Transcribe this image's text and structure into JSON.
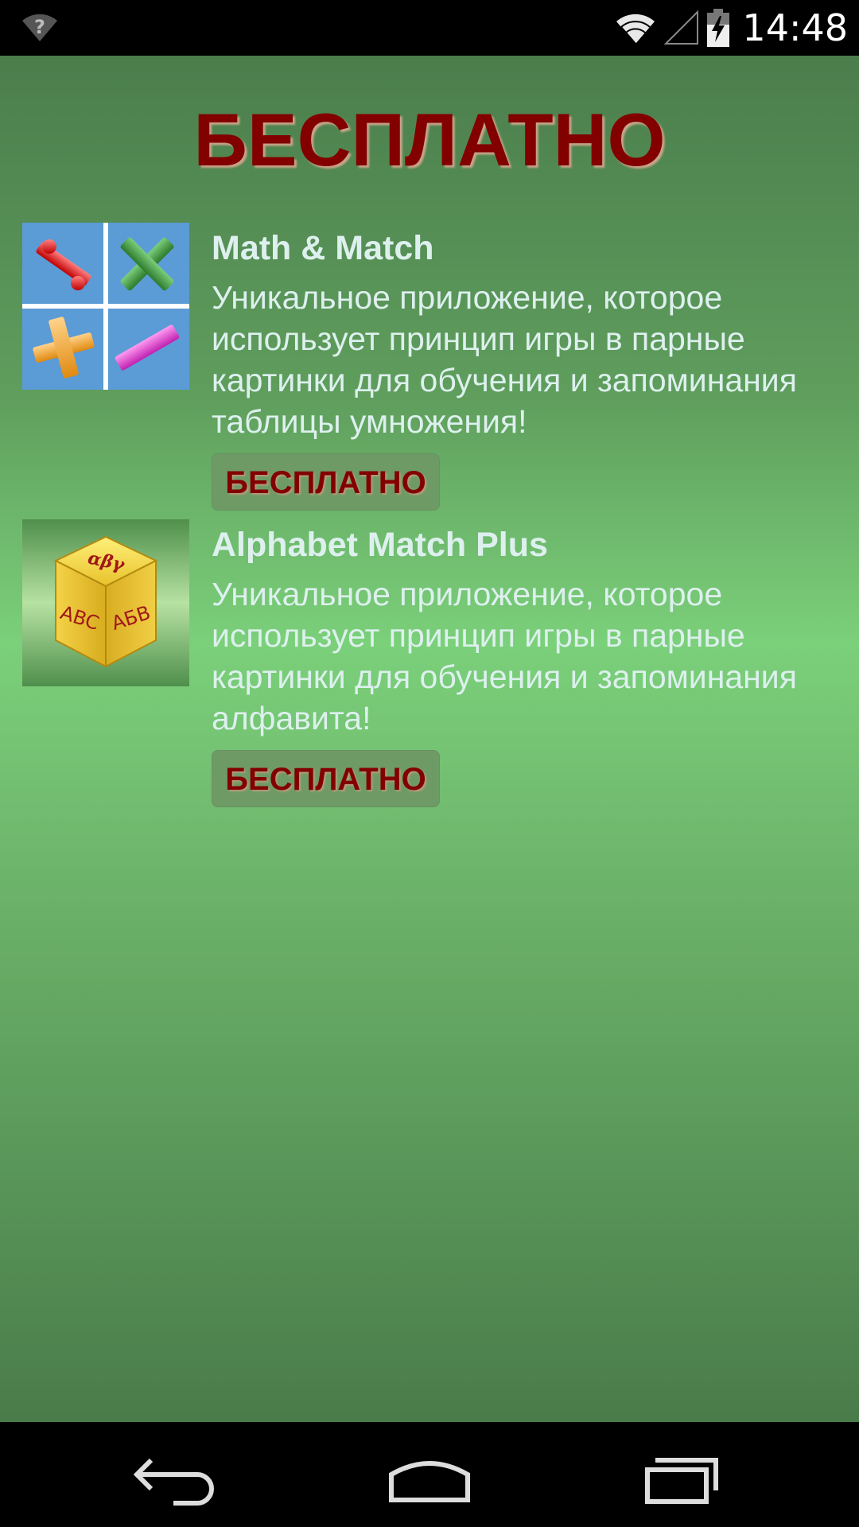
{
  "status_bar": {
    "time": "14:48",
    "icons": [
      "wifi-question-icon",
      "wifi-icon",
      "signal-icon",
      "battery-charging-icon"
    ]
  },
  "page": {
    "title": "БЕСПЛАТНО"
  },
  "apps": [
    {
      "name": "Math & Match",
      "description": "Уникальное приложение, которое использует принцип игры в парные картинки для обучения и запоминания таблицы умножения!",
      "button_label": "БЕСПЛАТНО",
      "icon": "math-operations-icon"
    },
    {
      "name": "Alphabet Match Plus",
      "description": "Уникальное приложение, которое использует принцип игры в парные картинки для обучения и запоминания алфавита!",
      "button_label": "БЕСПЛАТНО",
      "icon": "alphabet-cube-icon"
    }
  ],
  "nav_bar": {
    "icons": [
      "back-icon",
      "home-icon",
      "recents-icon"
    ]
  },
  "colors": {
    "title": "#820000",
    "text": "#ddf0ee",
    "background_light": "#7bd07a",
    "background_dark": "#4a7b4a"
  }
}
